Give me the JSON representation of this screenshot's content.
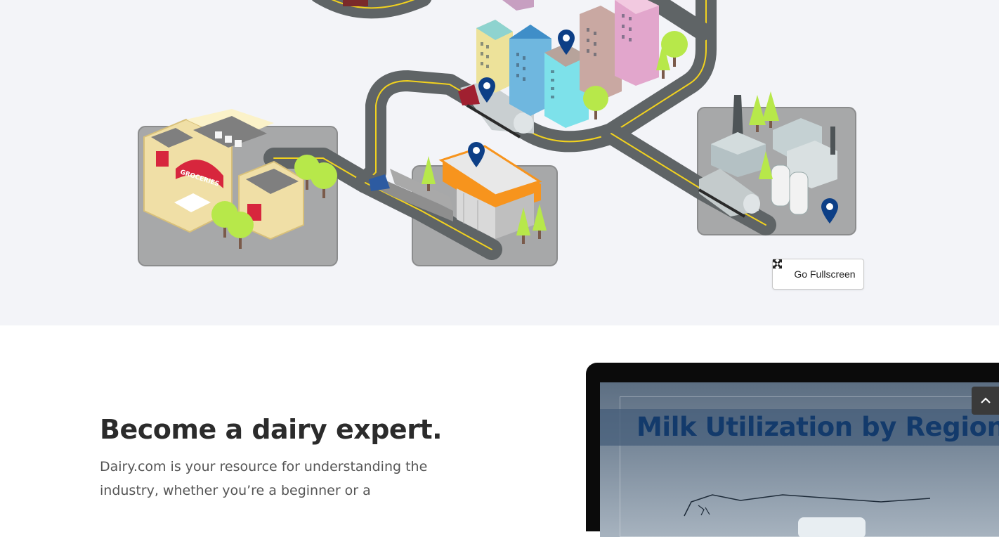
{
  "illustration": {
    "fullscreen_label": "Go Fullscreen",
    "fullscreen_icon": "expand-icon",
    "groceries_sign": "GROCERIES",
    "colors": {
      "road": "#5f6466",
      "road_line": "#f2d21e",
      "pin": "#0d3f86",
      "tree": "#b7e84a",
      "awning": "#f7941d"
    }
  },
  "intro": {
    "headline": "Become a dairy expert.",
    "body": "Dairy.com is your resource for understanding the industry, whether you’re a beginner or a"
  },
  "laptop": {
    "screen_title": "Milk Utilization by Region"
  },
  "scroll_top": {
    "icon": "chevron-up-icon"
  }
}
